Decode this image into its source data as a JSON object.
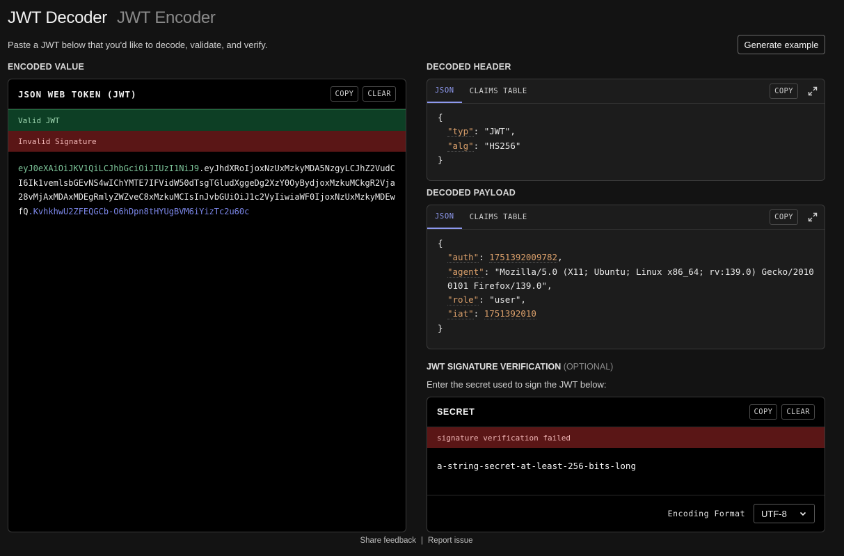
{
  "header": {
    "active_tab": "JWT Decoder",
    "inactive_tab": "JWT Encoder",
    "subtitle": "Paste a JWT below that you'd like to decode, validate, and verify.",
    "generate_label": "Generate example"
  },
  "encoded": {
    "section_label": "ENCODED VALUE",
    "panel_title": "JSON WEB TOKEN (JWT)",
    "copy_label": "COPY",
    "clear_label": "CLEAR",
    "status_valid": "Valid JWT",
    "status_invalid": "Invalid Signature",
    "token_header": "eyJ0eXAiOiJKV1QiLCJhbGciOiJIUzI1NiJ9",
    "token_payload": "eyJhdXRoIjoxNzUxMzkyMDA5NzgyLCJhZ2VudCI6Ik1vemlsbGEvNS4wIChYMTE7IFVidW50dTsgTGludXggeDg2XzY0OyBydjoxMzkuMCkgR2Vja28vMjAxMDAxMDEgRmlyZWZveC8xMzkuMCIsInJvbGUiOiJ1c2VyIiwiaWF0IjoxNzUxMzkyMDEwfQ",
    "token_signature": "KvhkhwU2ZFEQGCb-O6hDpn8tHYUgBVM6iYizTc2u60c",
    "dot": "."
  },
  "decoded_header": {
    "section_label": "DECODED HEADER",
    "tab_json": "JSON",
    "tab_claims": "CLAIMS TABLE",
    "copy_label": "COPY",
    "open_brace": "{",
    "close_brace": "}",
    "typ_key": "\"typ\"",
    "typ_value": "\"JWT\"",
    "alg_key": "\"alg\"",
    "alg_value": "\"HS256\""
  },
  "decoded_payload": {
    "section_label": "DECODED PAYLOAD",
    "tab_json": "JSON",
    "tab_claims": "CLAIMS TABLE",
    "copy_label": "COPY",
    "open_brace": "{",
    "close_brace": "}",
    "auth_key": "\"auth\"",
    "auth_value": "1751392009782",
    "agent_key": "\"agent\"",
    "agent_value": "\"Mozilla/5.0 (X11; Ubuntu; Linux x86_64; rv:139.0) Gecko/20100101 Firefox/139.0\"",
    "role_key": "\"role\"",
    "role_value": "\"user\"",
    "iat_key": "\"iat\"",
    "iat_value": "1751392010"
  },
  "signature": {
    "title_bold": "JWT SIGNATURE VERIFICATION",
    "title_optional": "(OPTIONAL)",
    "description": "Enter the secret used to sign the JWT below:",
    "panel_title": "SECRET",
    "copy_label": "COPY",
    "clear_label": "CLEAR",
    "status": "signature verification failed",
    "secret_value": "a-string-secret-at-least-256-bits-long",
    "encoding_label": "Encoding Format",
    "encoding_value": "UTF-8"
  },
  "footer": {
    "feedback": "Share feedback",
    "separator": "|",
    "report": "Report issue"
  },
  "colors": {
    "background": "#131313",
    "accent": "#8e99ef",
    "valid_bg": "#0d3f25",
    "invalid_bg": "#5a1616",
    "token_header": "#7ec79b",
    "token_signature": "#7b86e8",
    "json_key": "#dba06b"
  },
  "icons": {
    "expand": "expand-icon",
    "chevron": "chevron-down-icon"
  }
}
